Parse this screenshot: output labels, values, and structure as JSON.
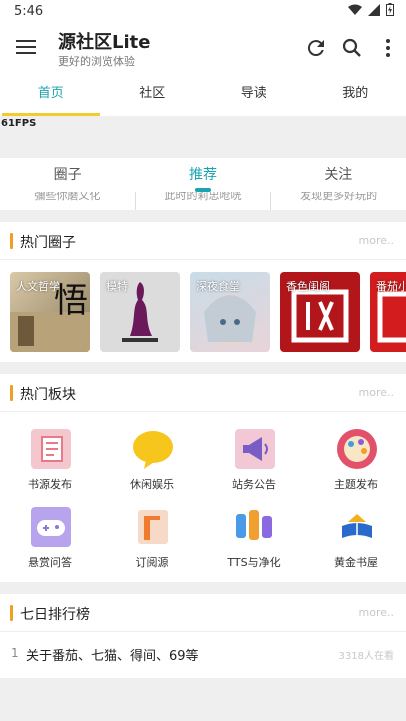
{
  "status_bar": {
    "time": "5:46"
  },
  "app_bar": {
    "title": "源社区Lite",
    "subtitle": "更好的浏览体验"
  },
  "top_tabs": [
    {
      "label": "首页",
      "active": true
    },
    {
      "label": "社区",
      "active": false
    },
    {
      "label": "导读",
      "active": false
    },
    {
      "label": "我的",
      "active": false
    }
  ],
  "fps": "61FPS",
  "sub_tabs": [
    {
      "label": "圈子",
      "active": false
    },
    {
      "label": "推荐",
      "active": true
    },
    {
      "label": "关注",
      "active": false
    }
  ],
  "sub_tab_partials": [
    "彌些你磨乂化",
    "此时的莉忠呛咣",
    "发现更多好玩的"
  ],
  "hot_circles": {
    "title": "热门圈子",
    "more": "more..",
    "items": [
      {
        "label": "人文哲学"
      },
      {
        "label": "模特"
      },
      {
        "label": "深夜食堂"
      },
      {
        "label": "香色闺阁"
      },
      {
        "label": "番茄小"
      }
    ]
  },
  "hot_boards": {
    "title": "热门板块",
    "more": "more..",
    "items": [
      {
        "label": "书源发布"
      },
      {
        "label": "休闲娱乐"
      },
      {
        "label": "站务公告"
      },
      {
        "label": "主题发布"
      },
      {
        "label": "悬赏问答"
      },
      {
        "label": "订阅源"
      },
      {
        "label": "TTS与净化"
      },
      {
        "label": "黄金书屋"
      }
    ]
  },
  "weekly_rank": {
    "title": "七日排行榜",
    "more": "more..",
    "items": [
      {
        "rank": "1",
        "title": "关于番茄、七猫、得间、69等",
        "views": "3318人在看"
      }
    ]
  },
  "colors": {
    "accent": "#1aa3b0",
    "tab_underline": "#f2cc2d",
    "section_bar": "#f0a020"
  }
}
